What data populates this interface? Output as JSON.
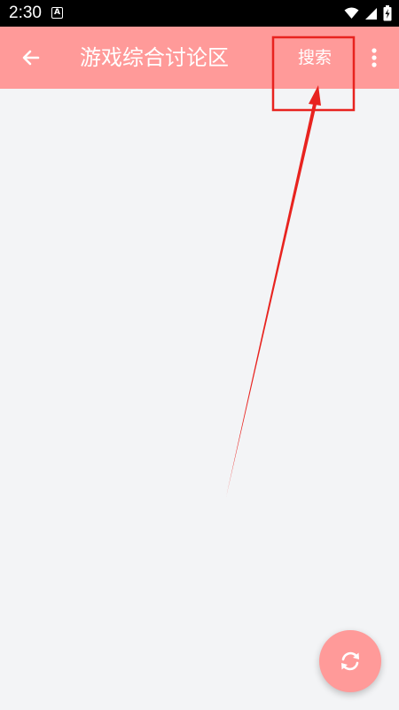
{
  "status_bar": {
    "time": "2:30",
    "icons": [
      "accessibility-a-icon",
      "wifi-icon",
      "signal-icon",
      "battery-charging-icon"
    ]
  },
  "app_bar": {
    "back_icon": "arrow-left-icon",
    "title": "游戏综合讨论区",
    "search_label": "搜索",
    "more_icon": "more-vertical-icon",
    "background_color": "#ff9a99"
  },
  "annotation": {
    "color": "#e8231f"
  },
  "fab": {
    "icon": "refresh-icon",
    "color": "#ff9a99"
  },
  "colors": {
    "content_background": "#f3f4f6",
    "status_bar_background": "#000000"
  }
}
